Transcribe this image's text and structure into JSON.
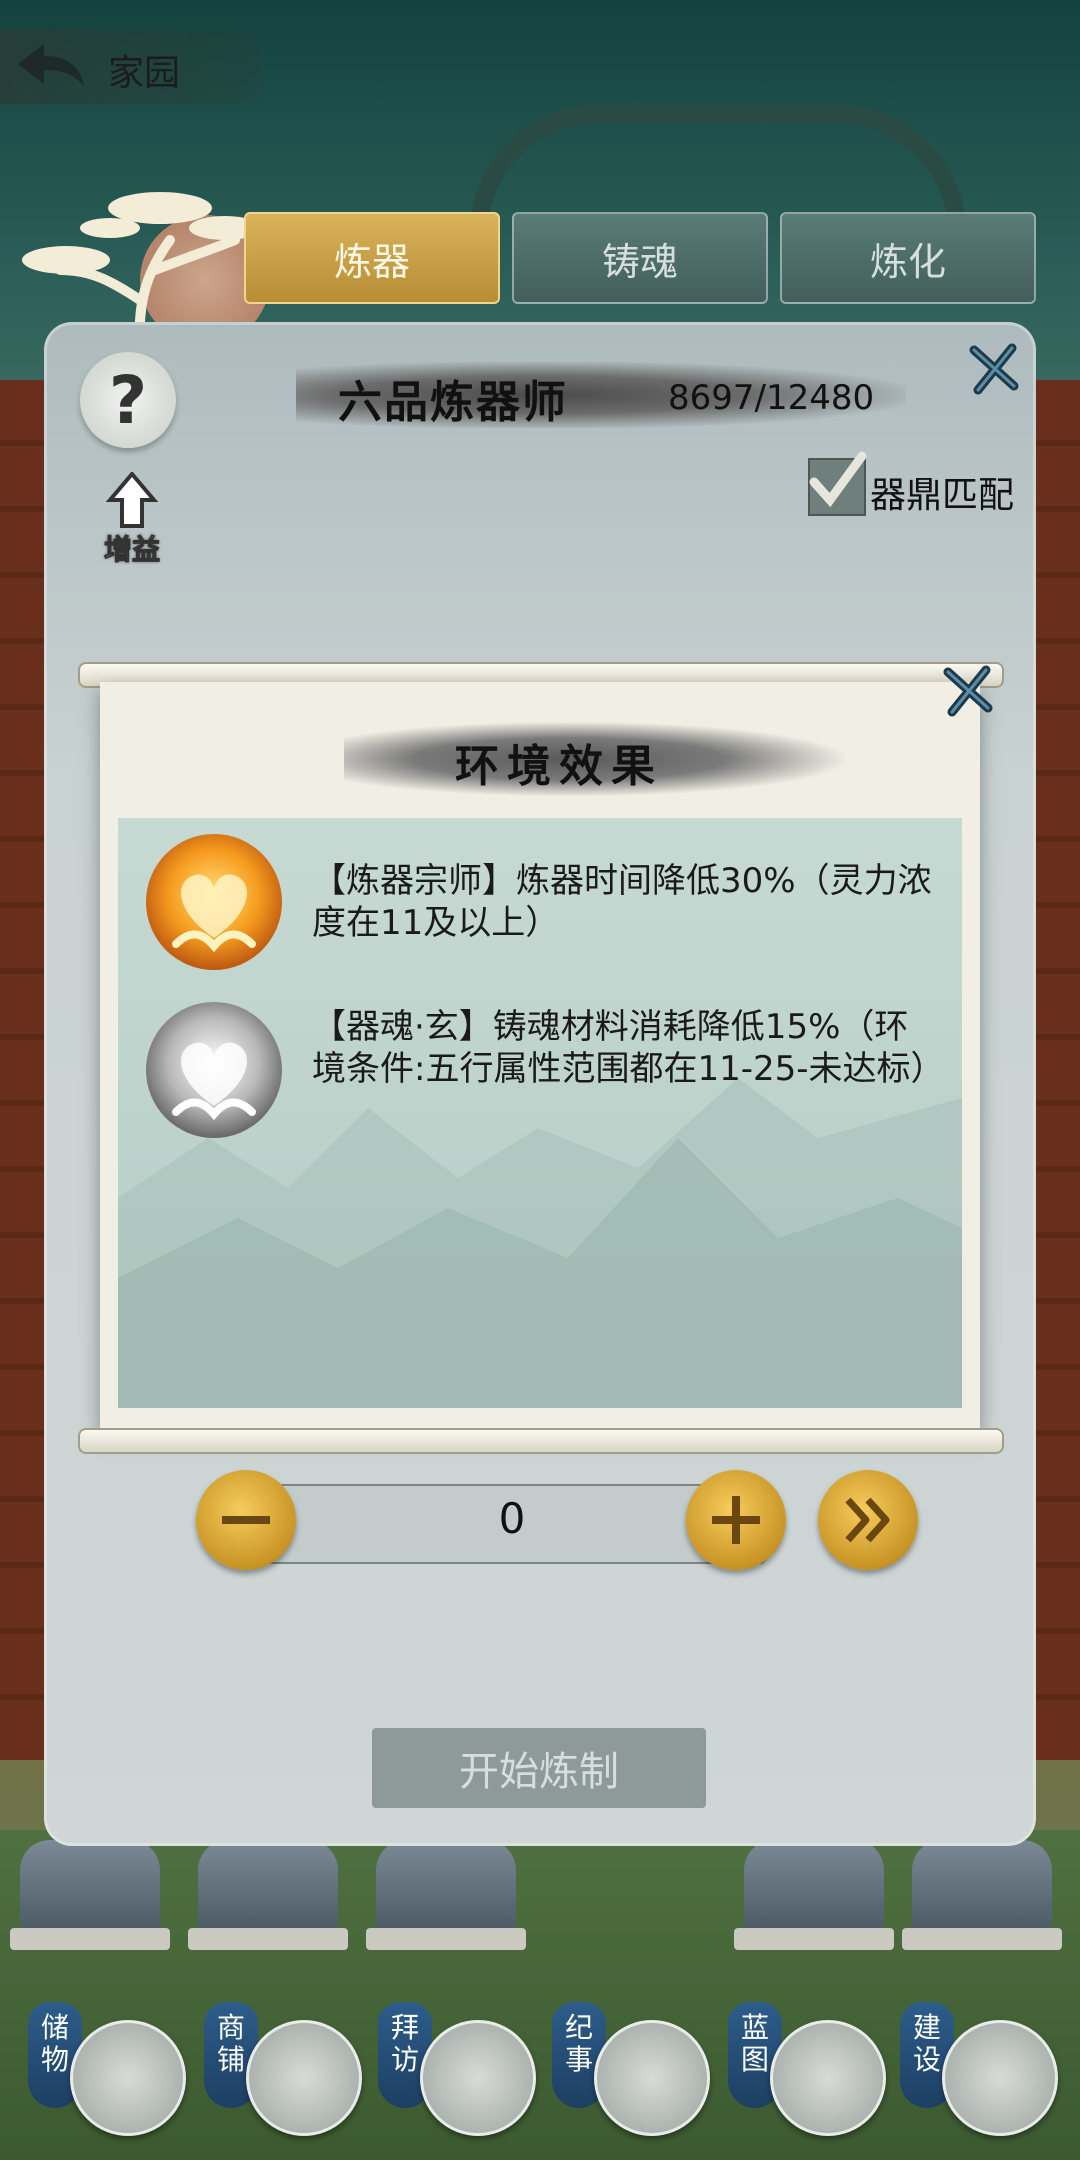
{
  "header": {
    "back_label": "家园"
  },
  "tabs": [
    {
      "label": "炼器",
      "active": true
    },
    {
      "label": "铸魂",
      "active": false
    },
    {
      "label": "炼化",
      "active": false
    }
  ],
  "panel": {
    "help_glyph": "?",
    "boost_label": "增益",
    "rank_title": "六品炼器师",
    "rank_progress": "8697/12480",
    "match_label": "器鼎匹配",
    "match_checked": true,
    "quantity": "0",
    "start_label": "开始炼制"
  },
  "popup": {
    "title": "环境效果",
    "effects": [
      {
        "text": "【炼器宗师】炼器时间降低30%（灵力浓度在11及以上）",
        "icon": "golden-heart-hands-icon",
        "active": true
      },
      {
        "text": "【器魂·玄】铸魂材料消耗降低15%（环境条件:五行属性范围都在11-25-未达标）",
        "icon": "silver-heart-hands-icon",
        "active": false
      }
    ]
  },
  "bottom_nav": [
    {
      "label": "储物",
      "icon": "bag-icon"
    },
    {
      "label": "商铺",
      "icon": "shop-icon"
    },
    {
      "label": "拜访",
      "icon": "visit-icon"
    },
    {
      "label": "纪事",
      "icon": "scroll-icon"
    },
    {
      "label": "蓝图",
      "icon": "map-icon"
    },
    {
      "label": "建设",
      "icon": "hammer-icon"
    }
  ],
  "colors": {
    "tab_active": "#c9a047",
    "tab_inactive": "#4f6d69",
    "round_button": "#e0ad3a",
    "panel": "#c9d2d2",
    "effects_box": "#c0d4ce"
  }
}
